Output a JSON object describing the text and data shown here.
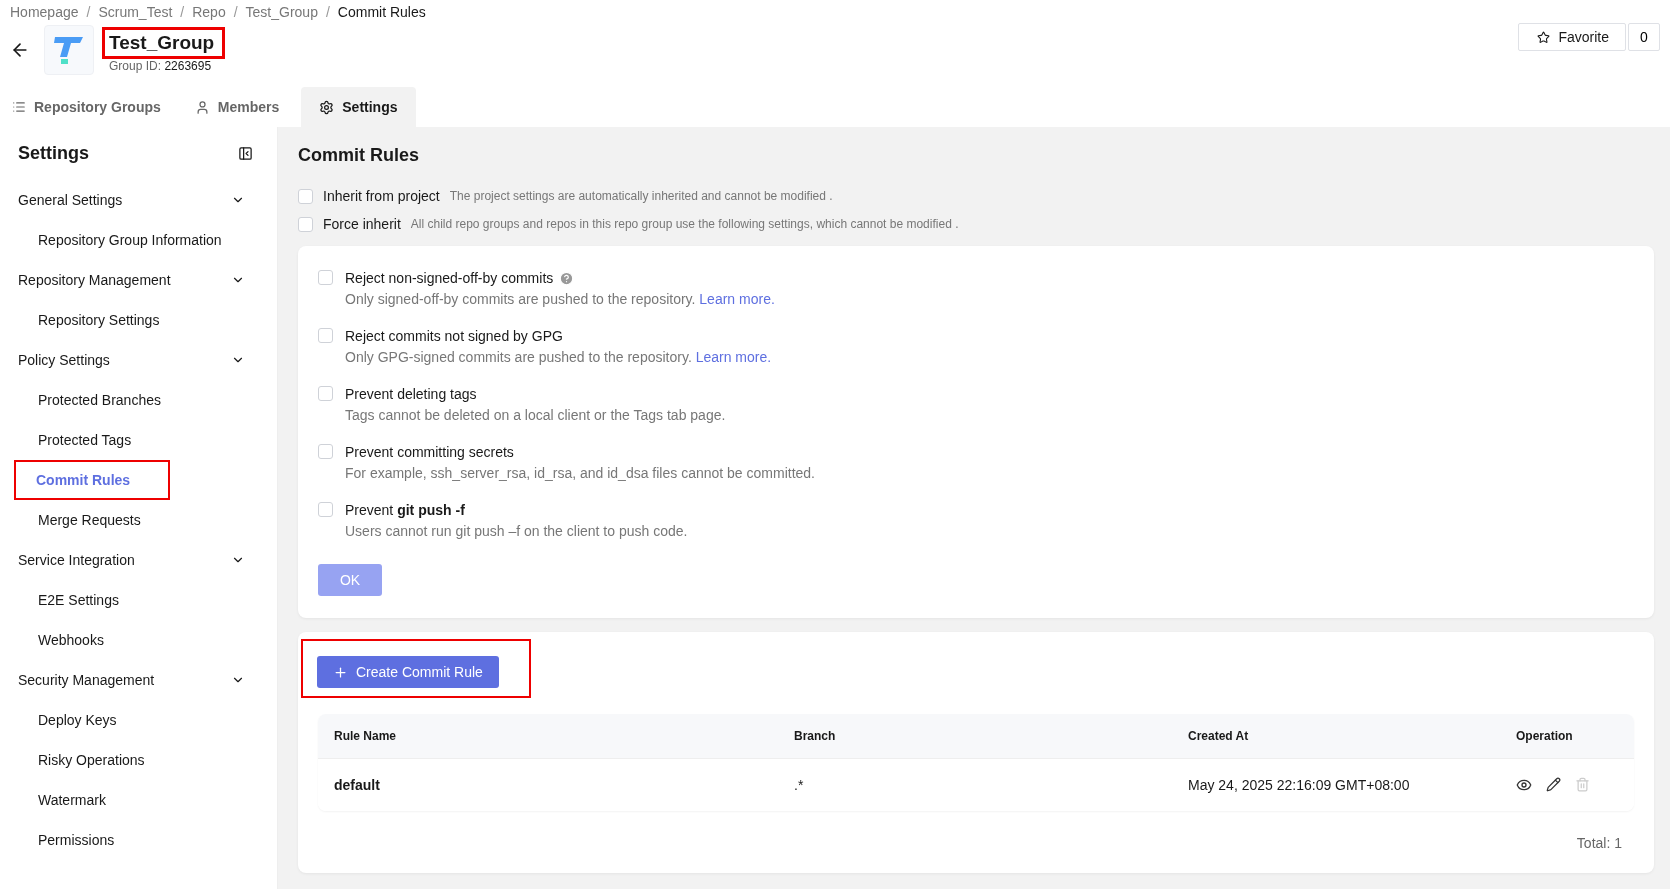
{
  "breadcrumb": [
    {
      "label": "Homepage",
      "current": false
    },
    {
      "label": "Scrum_Test",
      "current": false
    },
    {
      "label": "Repo",
      "current": false
    },
    {
      "label": "Test_Group",
      "current": false
    },
    {
      "label": "Commit Rules",
      "current": true
    }
  ],
  "separator": "/",
  "group": {
    "name": "Test_Group",
    "highlighted": true,
    "id_label": "Group ID:",
    "id": "2263695"
  },
  "favorite": {
    "label": "Favorite",
    "count": "0"
  },
  "tabs": [
    {
      "label": "Repository Groups",
      "selected": false
    },
    {
      "label": "Members",
      "selected": false
    },
    {
      "label": "Settings",
      "selected": true
    }
  ],
  "sidebar": {
    "title": "Settings",
    "sections": [
      {
        "label": "General Settings",
        "expanded": true,
        "items": [
          {
            "label": "Repository Group Information",
            "selected": false,
            "highlighted": false
          }
        ]
      },
      {
        "label": "Repository Management",
        "expanded": true,
        "items": [
          {
            "label": "Repository Settings",
            "selected": false,
            "highlighted": false
          }
        ]
      },
      {
        "label": "Policy Settings",
        "expanded": true,
        "items": [
          {
            "label": "Protected Branches",
            "selected": false,
            "highlighted": false
          },
          {
            "label": "Protected Tags",
            "selected": false,
            "highlighted": false
          },
          {
            "label": "Commit Rules",
            "selected": true,
            "highlighted": true
          },
          {
            "label": "Merge Requests",
            "selected": false,
            "highlighted": false
          }
        ]
      },
      {
        "label": "Service Integration",
        "expanded": true,
        "items": [
          {
            "label": "E2E Settings",
            "selected": false,
            "highlighted": false
          },
          {
            "label": "Webhooks",
            "selected": false,
            "highlighted": false
          }
        ]
      },
      {
        "label": "Security Management",
        "expanded": true,
        "items": [
          {
            "label": "Deploy Keys",
            "selected": false,
            "highlighted": false
          },
          {
            "label": "Risky Operations",
            "selected": false,
            "highlighted": false
          },
          {
            "label": "Watermark",
            "selected": false,
            "highlighted": false
          },
          {
            "label": "Permissions",
            "selected": false,
            "highlighted": false
          }
        ]
      }
    ]
  },
  "page_title": "Commit Rules",
  "inherit_options": [
    {
      "label": "Inherit from project",
      "hint": "The project settings are automatically inherited and cannot be modified .",
      "checked": false
    },
    {
      "label": "Force inherit",
      "hint": "All child repo groups and repos in this repo group use the following settings, which cannot be modified .",
      "checked": false
    }
  ],
  "rules": [
    {
      "label": "Reject non-signed-off-by commits",
      "help": true,
      "description": "Only signed-off-by commits are pushed to the repository.",
      "link": "Learn more.",
      "checked": false
    },
    {
      "label": "Reject commits not signed by GPG",
      "help": false,
      "description": "Only GPG-signed commits are pushed to the repository.",
      "link": "Learn more.",
      "checked": false
    },
    {
      "label": "Prevent deleting tags",
      "help": false,
      "description": "Tags cannot be deleted on a local client or the Tags tab page.",
      "checked": false
    },
    {
      "label": "Prevent committing secrets",
      "help": false,
      "description": "For example, ssh_server_rsa, id_rsa, and id_dsa files cannot be committed.",
      "checked": false
    },
    {
      "label": "Prevent  **git push -f**",
      "help": false,
      "description": "Users cannot run git push –f on the client to push code.",
      "checked": false
    }
  ],
  "ok_button": {
    "label": "OK",
    "disabled": true
  },
  "create_button": {
    "label": "Create Commit Rule",
    "highlighted": true
  },
  "table": {
    "columns": [
      "Rule Name",
      "Branch",
      "Created At",
      "Operation"
    ],
    "rows": [
      {
        "name": "default",
        "branch": ".*",
        "created_at": "May 24, 2025 22:16:09 GMT+08:00",
        "delete_disabled": true
      }
    ]
  },
  "total": "Total: 1"
}
